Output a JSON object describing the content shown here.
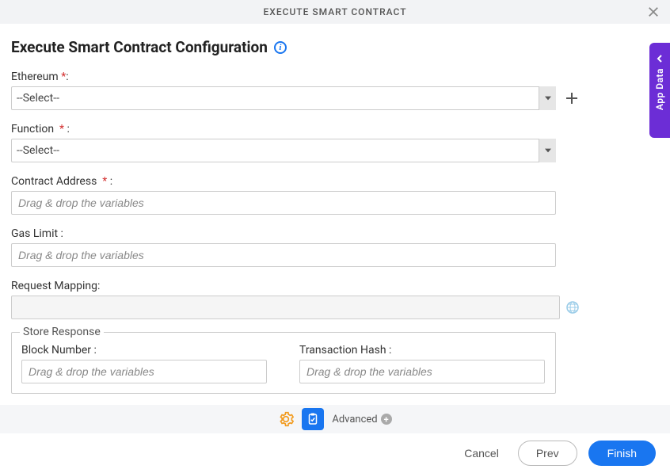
{
  "header": {
    "title": "EXECUTE SMART CONTRACT"
  },
  "page": {
    "title": "Execute Smart Contract Configuration"
  },
  "form": {
    "ethereum": {
      "label": "Ethereum",
      "colon": ":",
      "selected": "--Select--"
    },
    "function": {
      "label": "Function",
      "colon": ":",
      "selected": "--Select--"
    },
    "contract_address": {
      "label": "Contract Address",
      "colon": ":",
      "placeholder": "Drag & drop the variables"
    },
    "gas_limit": {
      "label": "Gas Limit :",
      "placeholder": "Drag & drop the variables"
    },
    "request_mapping": {
      "label": "Request Mapping:"
    },
    "store_response": {
      "legend": "Store Response",
      "block_number": {
        "label": "Block Number :",
        "placeholder": "Drag & drop the variables"
      },
      "transaction_hash": {
        "label": "Transaction Hash :",
        "placeholder": "Drag & drop the variables"
      }
    }
  },
  "bottom_bar": {
    "advanced_label": "Advanced"
  },
  "footer": {
    "cancel": "Cancel",
    "prev": "Prev",
    "finish": "Finish"
  },
  "side_tab": {
    "label": "App Data"
  },
  "required_star": "*"
}
